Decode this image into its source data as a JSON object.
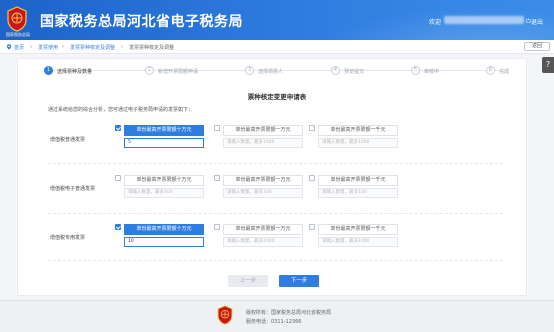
{
  "header": {
    "logo_caption": "国家税务总局",
    "site_title": "国家税务总局河北省电子税务局",
    "welcome": "欢迎",
    "logout": "退出"
  },
  "breadcrumb": {
    "home": "首页",
    "items": [
      "发票使用",
      "发票票种核定及调整",
      "发票票种核定及调整"
    ],
    "back": "返回"
  },
  "side_tab": "?",
  "steps": [
    {
      "num": "1",
      "label": "选择票种及数量"
    },
    {
      "num": "2",
      "label": "新增开票限额申请"
    },
    {
      "num": "3",
      "label": "选择领票人"
    },
    {
      "num": "4",
      "label": "预览提交"
    },
    {
      "num": "5",
      "label": "审核中"
    },
    {
      "num": "6",
      "label": "完成"
    }
  ],
  "form": {
    "title": "票种核定变更申请表",
    "intro": "通过系统给您的综合分析，您可通过电子税务局申请的发票如下："
  },
  "rows": [
    {
      "label": "增值税普通发票",
      "options": [
        {
          "head": "单份最高开票限额十万元",
          "value": "5",
          "placeholder": "",
          "checked": true
        },
        {
          "head": "单份最高开票限额一万元",
          "value": "",
          "placeholder": "请输入数量，最多1000",
          "checked": false
        },
        {
          "head": "单份最高开票限额一千元",
          "value": "",
          "placeholder": "请输入数量，最多1000",
          "checked": false
        }
      ]
    },
    {
      "label": "增值税电子普通发票",
      "options": [
        {
          "head": "单份最高开票限额十万元",
          "value": "",
          "placeholder": "请输入数量，最多100",
          "checked": false
        },
        {
          "head": "单份最高开票限额一万元",
          "value": "",
          "placeholder": "请输入数量，最多100",
          "checked": false
        },
        {
          "head": "单份最高开票限额一千元",
          "value": "",
          "placeholder": "请输入数量，最多100",
          "checked": false
        }
      ]
    },
    {
      "label": "增值税专用发票",
      "options": [
        {
          "head": "单份最高开票限额十万元",
          "value": "10",
          "placeholder": "",
          "checked": true
        },
        {
          "head": "单份最高开票限额一万元",
          "value": "",
          "placeholder": "请输入数量，最多1000",
          "checked": false
        },
        {
          "head": "单份最高开票限额一千元",
          "value": "",
          "placeholder": "请输入数量，最多1000",
          "checked": false
        }
      ]
    }
  ],
  "buttons": {
    "prev": "上一步",
    "next": "下一步"
  },
  "footer": {
    "owner": "版权所有：国家税务总局河北省税务局",
    "phone": "服务电话：0311-12366"
  },
  "colors": {
    "primary": "#2f7de0",
    "header": "#1d63c9"
  }
}
